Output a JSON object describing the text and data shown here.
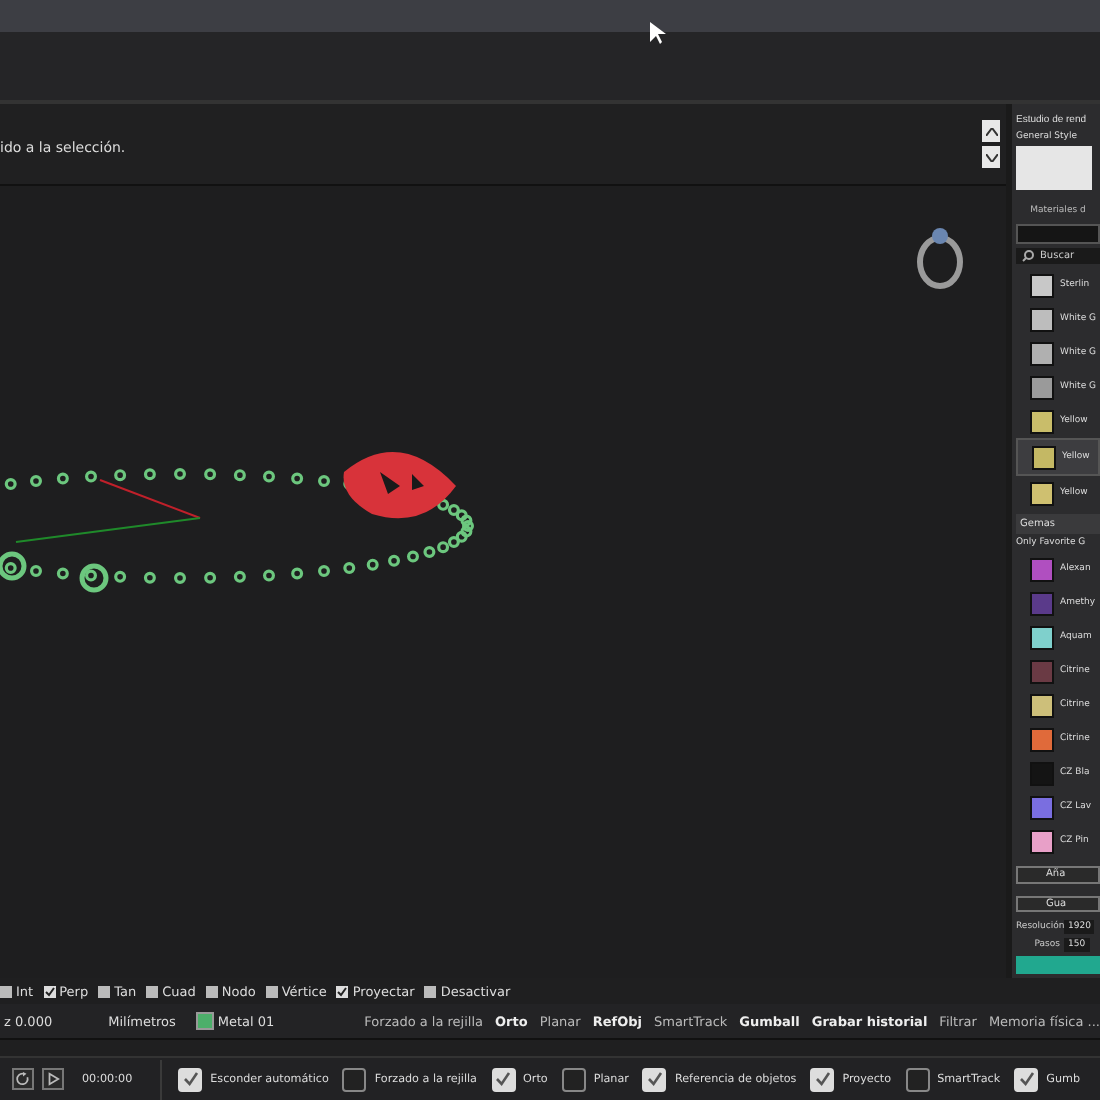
{
  "command_area": {
    "prompt": "ido a la selección."
  },
  "osnaps": [
    {
      "label": "Int",
      "checked": false
    },
    {
      "label": "Perp",
      "checked": true
    },
    {
      "label": "Tan",
      "checked": false
    },
    {
      "label": "Cuad",
      "checked": false
    },
    {
      "label": "Nodo",
      "checked": false
    },
    {
      "label": "Vértice",
      "checked": false
    },
    {
      "label": "Proyectar",
      "checked": true
    },
    {
      "label": "Desactivar",
      "checked": false
    }
  ],
  "status_bar": {
    "coordinate": "z 0.000",
    "units": "Milímetros",
    "layer": "Metal 01",
    "toggles": [
      {
        "label": "Forzado a la rejilla",
        "on": false
      },
      {
        "label": "Orto",
        "on": true
      },
      {
        "label": "Planar",
        "on": false
      },
      {
        "label": "RefObj",
        "on": true
      },
      {
        "label": "SmartTrack",
        "on": false
      },
      {
        "label": "Gumball",
        "on": true
      },
      {
        "label": "Grabar historial",
        "on": true
      },
      {
        "label": "Filtrar",
        "on": false
      },
      {
        "label": "Memoria física ...",
        "on": false
      }
    ]
  },
  "bottom_bar": {
    "time": "00:00:00",
    "options": [
      {
        "label": "Esconder automático",
        "checked": true
      },
      {
        "label": "Forzado a la rejilla",
        "checked": false
      },
      {
        "label": "Orto",
        "checked": true
      },
      {
        "label": "Planar",
        "checked": false
      },
      {
        "label": "Referencia de objetos",
        "checked": true
      },
      {
        "label": "Proyecto",
        "checked": true
      },
      {
        "label": "SmartTrack",
        "checked": false
      },
      {
        "label": "Gumb",
        "checked": true
      }
    ]
  },
  "render_panel": {
    "title": "Estudio de rend",
    "style_label": "General Style",
    "materials_label": "Materiales d",
    "search_placeholder": "Buscar",
    "materials": [
      {
        "name": "Sterlin",
        "color": "#c8c8c8",
        "selected": false
      },
      {
        "name": "White G",
        "color": "#bdbdbd",
        "selected": false
      },
      {
        "name": "White G",
        "color": "#b0b0b0",
        "selected": false
      },
      {
        "name": "White G",
        "color": "#9a9a9a",
        "selected": false
      },
      {
        "name": "Yellow",
        "color": "#c9bd6a",
        "selected": false
      },
      {
        "name": "Yellow",
        "color": "#c4b864",
        "selected": true
      },
      {
        "name": "Yellow",
        "color": "#cfc070",
        "selected": false
      }
    ],
    "gems_title": "Gemas",
    "gems_filter": "Only Favorite G",
    "gems": [
      {
        "name": "Alexan",
        "color": "#b04fc0"
      },
      {
        "name": "Amethy",
        "color": "#5a3a8a"
      },
      {
        "name": "Aquam",
        "color": "#7fd0cc"
      },
      {
        "name": "Citrine",
        "color": "#6a3a44"
      },
      {
        "name": "Citrine",
        "color": "#cdbf7a"
      },
      {
        "name": "Citrine",
        "color": "#e06a3a"
      },
      {
        "name": "CZ Bla",
        "color": "#141414"
      },
      {
        "name": "CZ Lav",
        "color": "#7a6ee0"
      },
      {
        "name": "CZ Pin",
        "color": "#e8a0c8"
      }
    ],
    "add_button": "Aña",
    "save_button": "Gua",
    "resolution_label": "Resolución",
    "resolution": "1920",
    "steps_label": "Pasos",
    "steps": "150"
  }
}
